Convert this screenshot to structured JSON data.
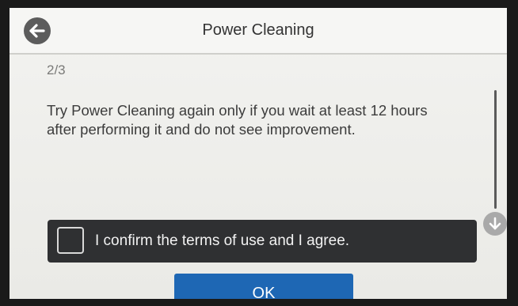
{
  "header": {
    "title": "Power Cleaning",
    "back_icon": "arrow-left-icon"
  },
  "content": {
    "page_indicator": "2/3",
    "message": "Try Power Cleaning again only if you wait at least 12 hours after performing it and do not see improvement."
  },
  "scroll": {
    "down_icon": "arrow-down-icon"
  },
  "confirm": {
    "label": "I confirm the terms of use and I agree.",
    "checked": false
  },
  "footer": {
    "ok_label": "OK"
  },
  "colors": {
    "header_bg": "#f6f6f4",
    "screen_bg": "#efefec",
    "confirm_bar_bg": "#2f3032",
    "ok_button_bg": "#1e67b4",
    "back_button_bg": "#5c5c5c",
    "scroll_button_bg": "#a9a9a9"
  }
}
